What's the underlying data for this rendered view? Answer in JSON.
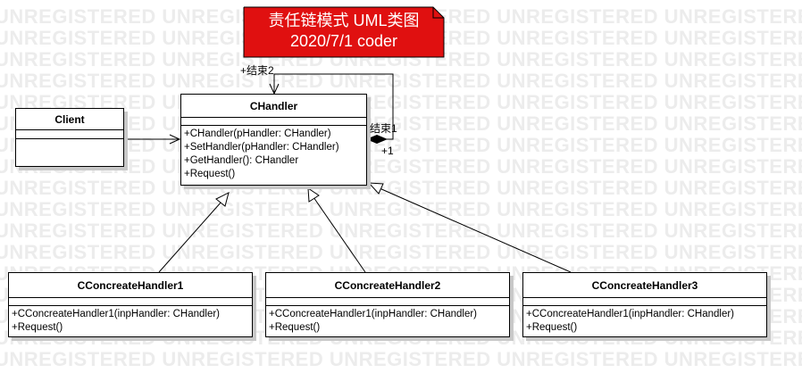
{
  "watermark": {
    "text": "UNREGISTERED UNREGISTERED UNREGISTERED UNREGISTERED UNREGISTERED UNREGISTERED UNREGISTERED"
  },
  "note": {
    "line1": "责任链模式 UML类图",
    "line2": "2020/7/1 coder",
    "fill": "#e01010"
  },
  "classes": {
    "client": {
      "name": "Client",
      "operations": []
    },
    "chandler": {
      "name": "CHandler",
      "operations": [
        "+CHandler(pHandler: CHandler)",
        "+SetHandler(pHandler: CHandler)",
        "+GetHandler(): CHandler",
        "+Request()"
      ]
    },
    "concrete1": {
      "name": "CConcreateHandler1",
      "operations": [
        "+CConcreateHandler1(inpHandler: CHandler)",
        "+Request()"
      ]
    },
    "concrete2": {
      "name": "CConcreateHandler2",
      "operations": [
        "+CConcreateHandler1(inpHandler: CHandler)",
        "+Request()"
      ]
    },
    "concrete3": {
      "name": "CConcreateHandler3",
      "operations": [
        "+CConcreateHandler1(inpHandler: CHandler)",
        "+Request()"
      ]
    }
  },
  "association": {
    "end2_label": "+结束2",
    "end1_label": "结束1",
    "end1_multiplicity": "+1"
  }
}
